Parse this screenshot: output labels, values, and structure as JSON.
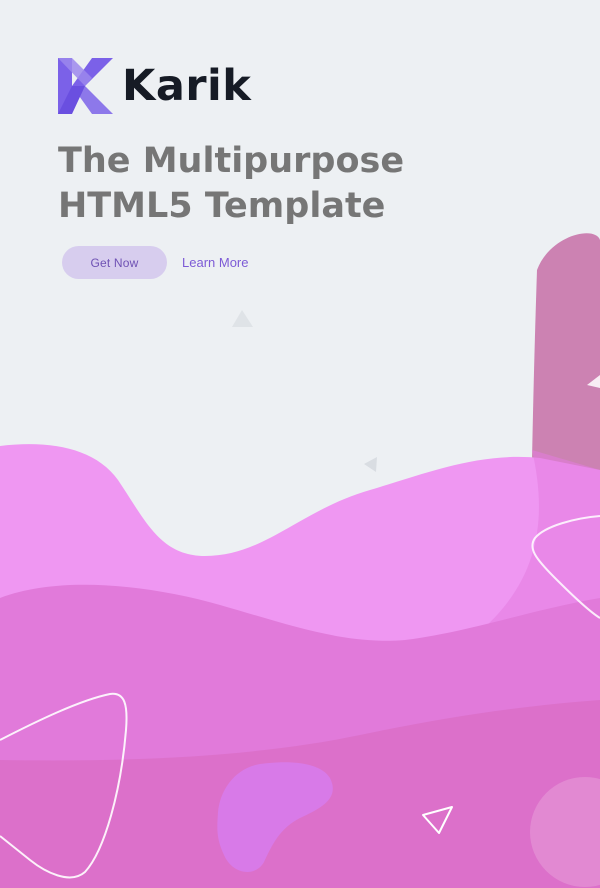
{
  "brand": {
    "name": "Karik",
    "logo_icon": "karik-k-logo-icon",
    "accent_color": "#7b61e8"
  },
  "hero": {
    "headline_line1": "The Multipurpose",
    "headline_line2": "HTML5 Template",
    "primary_button_label": "Get Now",
    "secondary_link_label": "Learn More"
  },
  "decorations": {
    "background_color": "#edf0f3",
    "wave_colors": [
      "#ee97f2",
      "#e17ada",
      "#d86bc1",
      "#cb82b0"
    ]
  }
}
